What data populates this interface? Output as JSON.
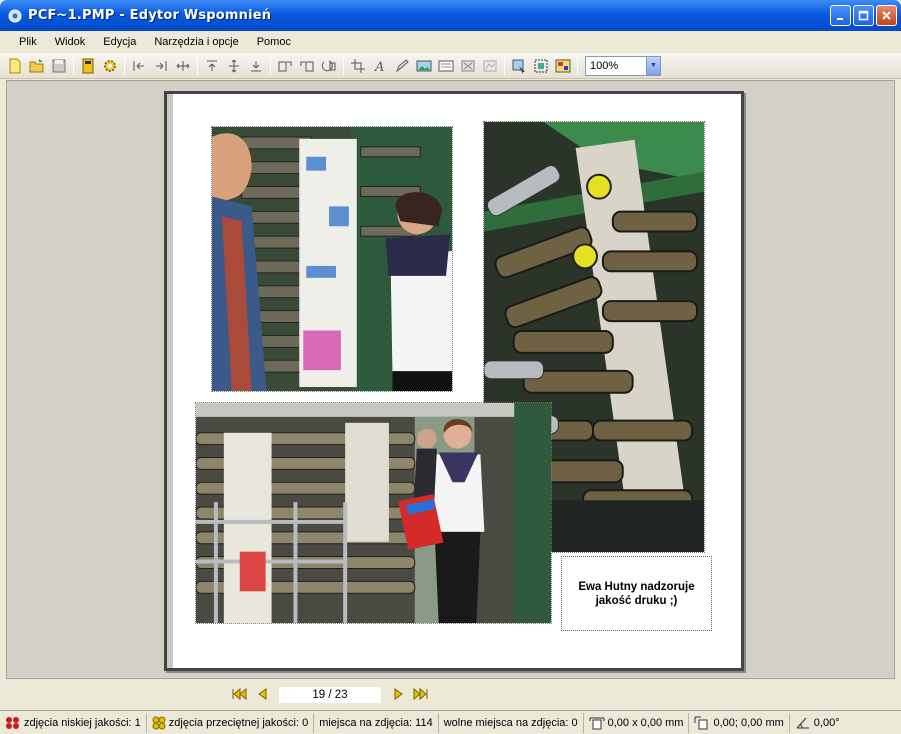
{
  "window": {
    "title": "PCF~1.PMP - Edytor Wspomnień",
    "icon": "app-icon"
  },
  "menu": [
    {
      "label": "Plik"
    },
    {
      "label": "Widok"
    },
    {
      "label": "Edycja"
    },
    {
      "label": "Narzędzia i opcje"
    },
    {
      "label": "Pomoc"
    }
  ],
  "toolbar": {
    "zoom_value": "100%"
  },
  "page": {
    "caption": "Ewa Hutny nadzoruje jakość druku ;)",
    "photos": [
      {
        "description": "photo-people-at-press"
      },
      {
        "description": "photo-press-rollers"
      },
      {
        "description": "photo-woman-with-newspaper"
      }
    ]
  },
  "navigation": {
    "page_counter": "19 / 23"
  },
  "status": {
    "low_quality": "zdjęcia niskiej jakości: 1",
    "medium_quality": "zdjęcia przeciętnej jakości: 0",
    "photo_slots": "miejsca na zdjęcia: 114",
    "free_slots": "wolne miejsca na zdjęcia: 0",
    "size": "0,00 x 0,00 mm",
    "position": "0,00; 0,00 mm",
    "angle": "0,00°"
  },
  "colors": {
    "titlebar": "#0a5adf",
    "low_quality_icon": "#cc1b1b",
    "medium_quality_icon": "#e0c000"
  }
}
